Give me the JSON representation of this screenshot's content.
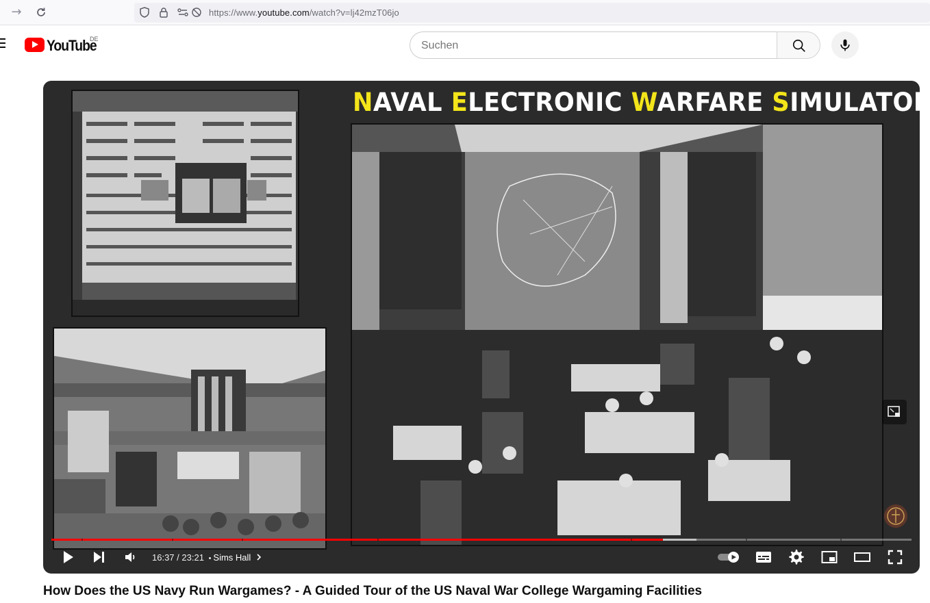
{
  "browser": {
    "url_prefix": "https://www.",
    "url_domain": "youtube.com",
    "url_path": "/watch?v=lj42mzT06jo"
  },
  "header": {
    "logo_text": "YouTube",
    "country_code": "DE",
    "search_placeholder": "Suchen"
  },
  "player": {
    "overlay_title_parts": [
      "N",
      "AVAL ",
      "E",
      "LECTRONIC ",
      "W",
      "ARFARE ",
      "S",
      "IMULATOR"
    ],
    "current_time": "16:37",
    "duration": "23:21",
    "time_separator": " / ",
    "chapter_separator": "•",
    "chapter": "Sims Hall",
    "progress_played": 0.711,
    "progress_loaded": 0.75,
    "colors": {
      "played": "#ff0000",
      "highlight": "#f3e51a"
    }
  },
  "video": {
    "title": "How Does the US Navy Run Wargames? - A Guided Tour of the US Naval War College Wargaming Facilities"
  }
}
